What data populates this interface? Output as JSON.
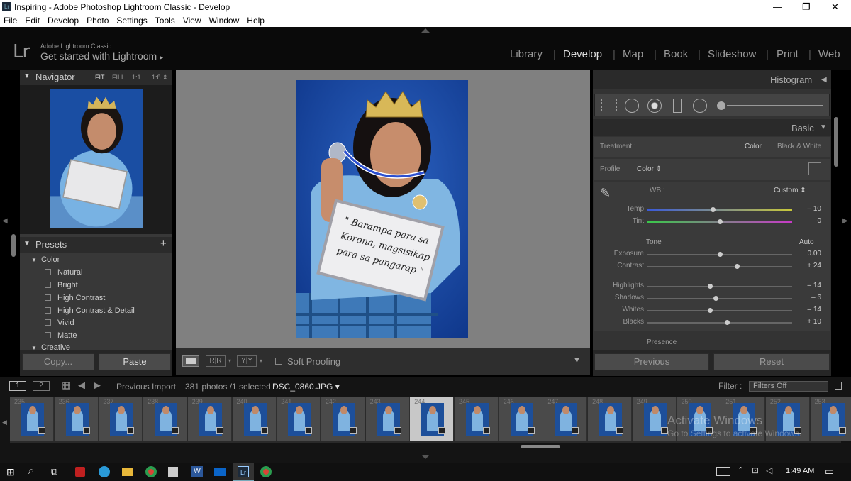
{
  "window": {
    "title": "Inspiring - Adobe Photoshop Lightroom Classic - Develop"
  },
  "menu": [
    "File",
    "Edit",
    "Develop",
    "Photo",
    "Settings",
    "Tools",
    "View",
    "Window",
    "Help"
  ],
  "identity": {
    "logo": "Lr",
    "small": "Adobe Lightroom Classic",
    "big": "Get started with Lightroom",
    "arrow": "▸"
  },
  "modules": [
    "Library",
    "Develop",
    "Map",
    "Book",
    "Slideshow",
    "Print",
    "Web"
  ],
  "navigator": {
    "title": "Navigator",
    "zoom": [
      "FIT",
      "FILL",
      "1:1",
      "1:8 ⇕"
    ]
  },
  "presets": {
    "title": "Presets",
    "group": "Color",
    "items": [
      "Natural",
      "Bright",
      "High Contrast",
      "High Contrast & Detail",
      "Vivid",
      "Matte"
    ],
    "next_group": "Creative"
  },
  "left_buttons": {
    "copy": "Copy...",
    "paste": "Paste"
  },
  "toolbar": {
    "soft_proofing": "Soft Proofing"
  },
  "right": {
    "histogram": "Histogram",
    "basic": "Basic",
    "treatment_label": "Treatment :",
    "treatment_color": "Color",
    "treatment_bw": "Black & White",
    "profile_label": "Profile :",
    "profile_value": "Color ⇕",
    "wb_label": "WB :",
    "wb_value": "Custom ⇕",
    "tone": "Tone",
    "auto": "Auto",
    "presence": "Presence",
    "sliders": [
      {
        "label": "Temp",
        "value": "– 10",
        "pos": 0.45
      },
      {
        "label": "Tint",
        "value": "0",
        "pos": 0.5
      },
      {
        "label": "Exposure",
        "value": "0.00",
        "pos": 0.5
      },
      {
        "label": "Contrast",
        "value": "+ 24",
        "pos": 0.62
      },
      {
        "label": "Highlights",
        "value": "– 14",
        "pos": 0.43
      },
      {
        "label": "Shadows",
        "value": "– 6",
        "pos": 0.47
      },
      {
        "label": "Whites",
        "value": "– 14",
        "pos": 0.43
      },
      {
        "label": "Blacks",
        "value": "+ 10",
        "pos": 0.55
      }
    ],
    "previous": "Previous",
    "reset": "Reset"
  },
  "filmstrip": {
    "view1": "1",
    "view2": "2",
    "source": "Previous Import",
    "count": "381 photos /1 selected /",
    "file": "DSC_0860.JPG ▾",
    "filter_label": "Filter :",
    "filter_value": "Filters Off",
    "numbers": [
      "235",
      "236",
      "237",
      "238",
      "239",
      "240",
      "241",
      "242",
      "243",
      "244",
      "245",
      "246",
      "247",
      "248",
      "249",
      "250",
      "251",
      "252",
      "253"
    ]
  },
  "photo_text": "\" Barampa para sa Korona, magsisikap para sa pangarap \"",
  "watermark": {
    "line1": "Activate Windows",
    "line2": "Go to Settings to activate Windows."
  },
  "taskbar": {
    "time": "1:49 AM"
  }
}
